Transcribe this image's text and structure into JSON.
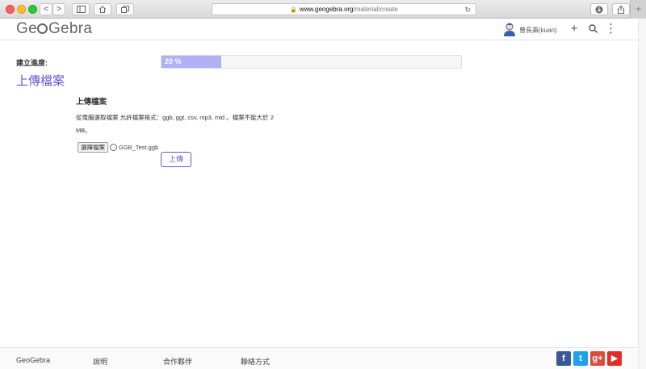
{
  "browser": {
    "url_host": "www.geogebra.org",
    "url_path": "/material/create",
    "nav_back": "<",
    "nav_forward": ">"
  },
  "header": {
    "logo_before": "Ge",
    "logo_after": "Gebra",
    "username": "曾長壽(kuan)",
    "add_symbol": "+",
    "menu_symbol": "⋮"
  },
  "main": {
    "progress_label": "建立進度:",
    "progress_text": "20 %",
    "progress_fraction": 0.2,
    "page_heading": "上傳檔案",
    "upload_title": "上傳檔案",
    "upload_description": "從電腦選取檔案 允許檔案格式：ggb, ggt, csv, mp3, mid 。檔案不能大於 2 MB。",
    "choose_file_label": "選擇檔案",
    "file_name": "GGB_Test.ggb",
    "upload_button": "上傳"
  },
  "footer": {
    "links": [
      "GeoGebra",
      "說明",
      "合作夥伴",
      "聯絡方式"
    ],
    "social": [
      "f",
      "t",
      "g+",
      "▶"
    ]
  },
  "colors": {
    "accent": "#6557d2",
    "progress_fill": "#b0b0f5"
  },
  "icons": [
    "lock-icon",
    "reload-icon",
    "download-icon",
    "share-icon",
    "avatar-icon",
    "search-icon",
    "menu-icon",
    "file-icon"
  ]
}
